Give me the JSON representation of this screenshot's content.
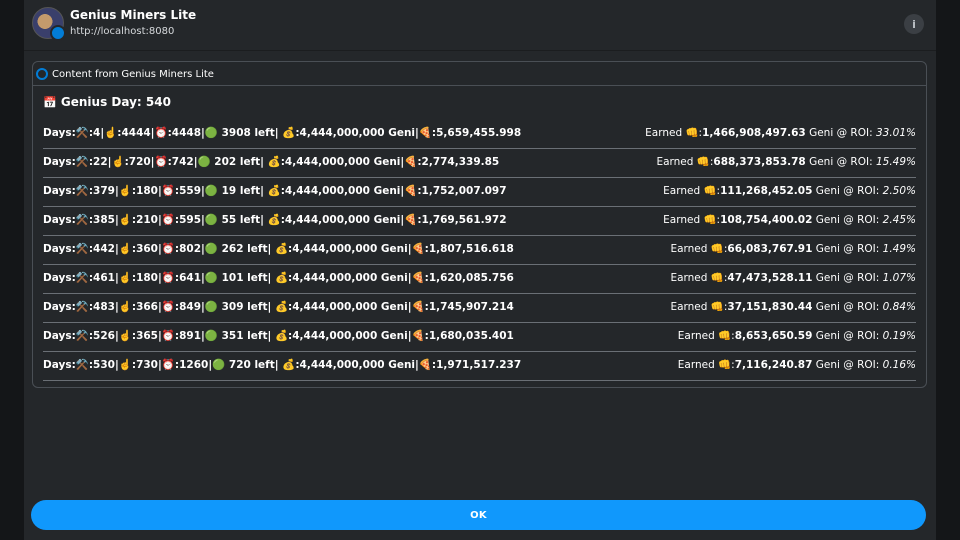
{
  "header": {
    "app_name": "Genius Miners Lite",
    "app_url": "http://localhost:8080",
    "info_icon": "i"
  },
  "content": {
    "label": "Content from Genius Miners Lite",
    "heading_icon": "📅",
    "heading": "Genius Day: 540",
    "rows": [
      {
        "left": "Days:⚒️:4|☝️:4444|⏰:4448|🟢 3908 left| 💰:4,444,000,000 Geni|🍕:5,659,455.998",
        "earned_label": "Earned 👊:",
        "earned_value": "1,466,908,497.63",
        "geni_roi": " Geni @ ROI: ",
        "roi": "33.01%"
      },
      {
        "left": "Days:⚒️:22|☝️:720|⏰:742|🟢 202 left| 💰:4,444,000,000 Geni|🍕:2,774,339.85",
        "earned_label": "Earned 👊:",
        "earned_value": "688,373,853.78",
        "geni_roi": " Geni @ ROI: ",
        "roi": "15.49%"
      },
      {
        "left": "Days:⚒️:379|☝️:180|⏰:559|🟢 19 left| 💰:4,444,000,000 Geni|🍕:1,752,007.097",
        "earned_label": "Earned 👊:",
        "earned_value": "111,268,452.05",
        "geni_roi": " Geni @ ROI: ",
        "roi": "2.50%"
      },
      {
        "left": "Days:⚒️:385|☝️:210|⏰:595|🟢 55 left| 💰:4,444,000,000 Geni|🍕:1,769,561.972",
        "earned_label": "Earned 👊:",
        "earned_value": "108,754,400.02",
        "geni_roi": " Geni @ ROI: ",
        "roi": "2.45%"
      },
      {
        "left": "Days:⚒️:442|☝️:360|⏰:802|🟢 262 left| 💰:4,444,000,000 Geni|🍕:1,807,516.618",
        "earned_label": "Earned 👊:",
        "earned_value": "66,083,767.91",
        "geni_roi": " Geni @ ROI: ",
        "roi": "1.49%"
      },
      {
        "left": "Days:⚒️:461|☝️:180|⏰:641|🟢 101 left| 💰:4,444,000,000 Geni|🍕:1,620,085.756",
        "earned_label": "Earned 👊:",
        "earned_value": "47,473,528.11",
        "geni_roi": " Geni @ ROI: ",
        "roi": "1.07%"
      },
      {
        "left": "Days:⚒️:483|☝️:366|⏰:849|🟢 309 left| 💰:4,444,000,000 Geni|🍕:1,745,907.214",
        "earned_label": "Earned 👊:",
        "earned_value": "37,151,830.44",
        "geni_roi": " Geni @ ROI: ",
        "roi": "0.84%"
      },
      {
        "left": "Days:⚒️:526|☝️:365|⏰:891|🟢 351 left| 💰:4,444,000,000 Geni|🍕:1,680,035.401",
        "earned_label": "Earned 👊:",
        "earned_value": "8,653,650.59",
        "geni_roi": " Geni @ ROI: ",
        "roi": "0.19%"
      },
      {
        "left": "Days:⚒️:530|☝️:730|⏰:1260|🟢 720 left| 💰:4,444,000,000 Geni|🍕:1,971,517.237",
        "earned_label": "Earned 👊:",
        "earned_value": "7,116,240.87",
        "geni_roi": " Geni @ ROI: ",
        "roi": "0.16%"
      }
    ]
  },
  "footer": {
    "ok_label": "OK"
  },
  "colors": {
    "accent": "#1098fc",
    "background": "#24272a"
  }
}
